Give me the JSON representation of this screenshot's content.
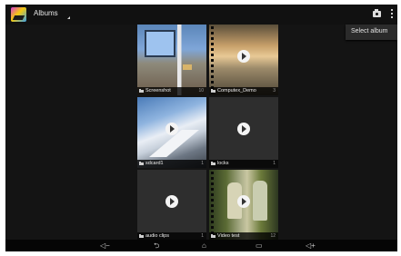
{
  "actionbar": {
    "title": "Albums",
    "menu_items": [
      "Select album"
    ]
  },
  "albums": [
    {
      "name": "Screenshot",
      "count": "10"
    },
    {
      "name": "Computex_Demo",
      "count": "3"
    },
    {
      "name": "sdcard1",
      "count": "1"
    },
    {
      "name": "locks",
      "count": "1"
    },
    {
      "name": "audio clips",
      "count": "1"
    },
    {
      "name": "Video test",
      "count": "12"
    }
  ],
  "icons": {
    "app": "gallery-app-icon",
    "camera": "camera-icon",
    "overflow": "overflow-menu-icon",
    "play": "play-icon",
    "nav": [
      "volume-down-icon",
      "back-icon",
      "home-icon",
      "recent-apps-icon",
      "volume-up-icon"
    ]
  },
  "colors": {
    "background": "#141414",
    "actionbar": "#111111",
    "navbar": "#050505"
  }
}
